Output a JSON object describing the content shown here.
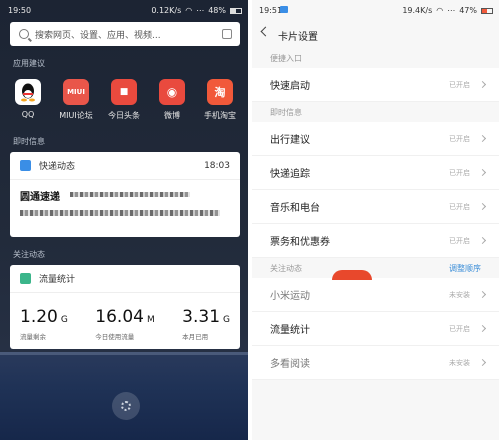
{
  "left": {
    "status": {
      "time": "19:50",
      "speed": "0.12K/s",
      "battery": "48%"
    },
    "search": {
      "placeholder": "搜索网页、设置、应用、视频..."
    },
    "apps_label": "应用建议",
    "apps": [
      {
        "label": "QQ",
        "icon": "qq-icon",
        "color": "#ffffff"
      },
      {
        "label": "MIUI论坛",
        "icon": "miui-icon",
        "icon_text": "MIUI",
        "color": "#e9564a"
      },
      {
        "label": "今日头条",
        "icon": "toutiao-icon",
        "icon_text": "■",
        "color": "#e94a3e"
      },
      {
        "label": "微博",
        "icon": "weibo-icon",
        "icon_text": "◉",
        "color": "#e94a3e"
      },
      {
        "label": "手机淘宝",
        "icon": "taobao-icon",
        "icon_text": "淘",
        "color": "#f1593a"
      }
    ],
    "instant_label": "即时信息",
    "express": {
      "title": "快递动态",
      "time": "18:03",
      "company": "圆通速递"
    },
    "follow_label": "关注动态",
    "traffic": {
      "title": "流量统计",
      "items": [
        {
          "value": "1.20",
          "unit": "G",
          "label": "流量剩余"
        },
        {
          "value": "16.04",
          "unit": "M",
          "label": "今日使用流量"
        },
        {
          "value": "3.31",
          "unit": "G",
          "label": "本月已用"
        }
      ]
    }
  },
  "right": {
    "status": {
      "time": "19:51",
      "speed": "19.4K/s",
      "battery": "47%"
    },
    "title": "卡片设置",
    "sections": {
      "shortcut": "便捷入口",
      "instant": "即时信息",
      "follow": "关注动态",
      "follow_action": "调整顺序"
    },
    "rows": [
      {
        "name": "快速启动",
        "state": "已开启"
      },
      {
        "name": "出行建议",
        "state": "已开启"
      },
      {
        "name": "快递追踪",
        "state": "已开启"
      },
      {
        "name": "音乐和电台",
        "state": "已开启"
      },
      {
        "name": "票务和优惠券",
        "state": "已开启"
      },
      {
        "name": "小米运动",
        "state": "未安装"
      },
      {
        "name": "流量统计",
        "state": "已开启"
      },
      {
        "name": "多看阅读",
        "state": "未安装"
      }
    ]
  }
}
